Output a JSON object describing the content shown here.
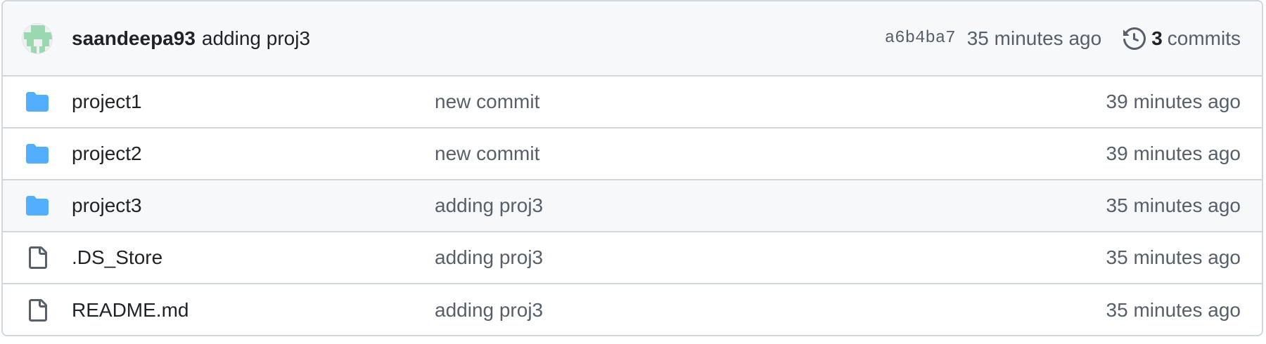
{
  "latest_commit": {
    "author": "saandeepa93",
    "message": "adding proj3",
    "sha": "a6b4ba7",
    "time": "35 minutes ago",
    "commit_count": "3",
    "commit_label": "commits",
    "avatar_icon": "identicon-avatar",
    "history_icon": "history-clock-icon"
  },
  "files": [
    {
      "name": "project1",
      "type": "folder",
      "message": "new commit",
      "time": "39 minutes ago"
    },
    {
      "name": "project2",
      "type": "folder",
      "message": "new commit",
      "time": "39 minutes ago"
    },
    {
      "name": "project3",
      "type": "folder",
      "message": "adding proj3",
      "time": "35 minutes ago"
    },
    {
      "name": ".DS_Store",
      "type": "file",
      "message": "adding proj3",
      "time": "35 minutes ago"
    },
    {
      "name": "README.md",
      "type": "file",
      "message": "adding proj3",
      "time": "35 minutes ago"
    }
  ],
  "colors": {
    "folder_icon": "#54aeff",
    "file_icon": "#57606a",
    "header_bg": "#f6f8fa",
    "border": "#d0d7de",
    "muted_text": "#57606a",
    "avatar_green": "#9bd7b0"
  }
}
